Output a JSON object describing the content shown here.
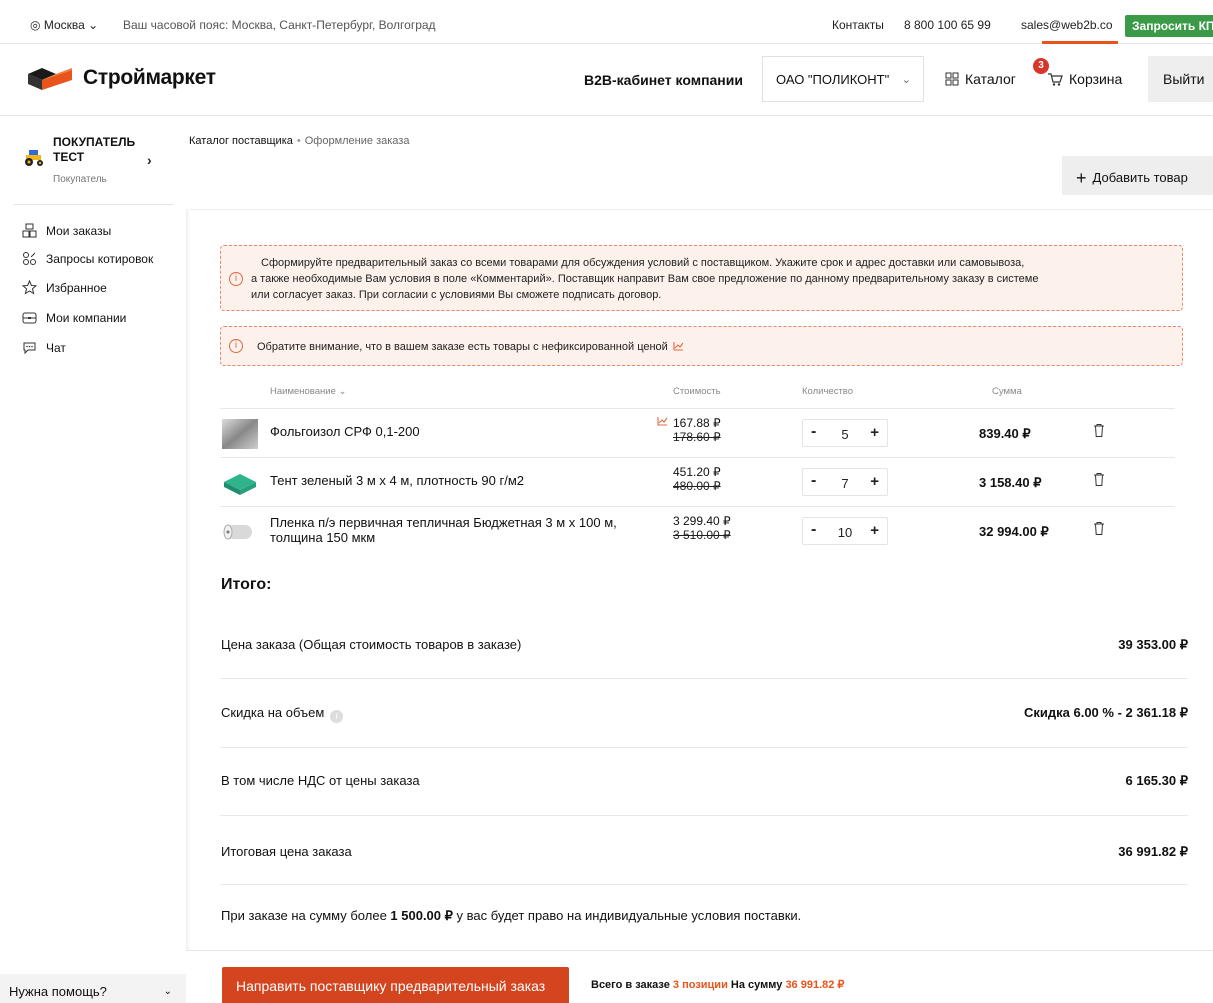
{
  "topbar": {
    "city": "Москва",
    "timezone": "Ваш часовой пояс: Москва, Санкт-Петербург, Волгоград",
    "contacts": "Контакты",
    "phone": "8 800 100 65 99",
    "email": "sales@web2b.co",
    "request_button": "Запросить КП"
  },
  "header": {
    "logo_text": "Строймаркет",
    "b2b_label": "B2B-кабинет компании",
    "company": "ОАО \"ПОЛИКОНТ\"",
    "catalog": "Каталог",
    "cart": "Корзина",
    "cart_count": "3",
    "logout": "Выйти"
  },
  "sidebar": {
    "user_name_line1": "ПОКУПАТЕЛЬ",
    "user_name_line2": "ТЕСТ",
    "user_role": "Покупатель",
    "items": [
      {
        "label": "Мои заказы",
        "icon": "orders-icon"
      },
      {
        "label": "Запросы котировок",
        "icon": "quotes-icon"
      },
      {
        "label": "Избранное",
        "icon": "star-icon"
      },
      {
        "label": "Мои компании",
        "icon": "briefcase-icon"
      },
      {
        "label": "Чат",
        "icon": "chat-icon"
      }
    ],
    "help": "Нужна помощь?"
  },
  "breadcrumb": {
    "parent": "Каталог поставщика",
    "current": "Оформление заказа"
  },
  "add_product_button": "Добавить товар",
  "notices": {
    "main_line1": "Сформируйте предварительный заказ со всеми товарами для обсуждения условий с поставщиком. Укажите срок и адрес доставки или самовывоза,",
    "main_line2": "а также необходимые Вам условия в поле «Комментарий». Поставщик направит Вам свое предложение по данному предварительному заказу в системе",
    "main_line3": "или согласует заказ. При согласии с условиями Вы сможете подписать договор.",
    "price_warning": "Обратите внимание, что в вашем заказе есть товары с нефиксированной ценой"
  },
  "table": {
    "columns": {
      "name": "Наименование",
      "price": "Стоимость",
      "quantity": "Количество",
      "sum": "Сумма"
    },
    "rows": [
      {
        "name": "Фольгоизол СРФ 0,1-200",
        "price": "167.88 ₽",
        "old_price": "178.60 ₽",
        "quantity": "5",
        "sum": "839.40 ₽",
        "floating_price": true
      },
      {
        "name": "Тент зеленый 3 м х 4 м, плотность 90 г/м2",
        "price": "451.20 ₽",
        "old_price": "480.00 ₽",
        "quantity": "7",
        "sum": "3 158.40 ₽",
        "floating_price": false
      },
      {
        "name_line1": "Пленка п/э первичная тепличная Бюджетная 3 м х 100 м,",
        "name_line2": "толщина 150 мкм",
        "price": "3 299.40 ₽",
        "old_price": "3 510.00 ₽",
        "quantity": "10",
        "sum": "32 994.00 ₽",
        "floating_price": false
      }
    ]
  },
  "totals": {
    "title": "Итого:",
    "order_price_label": "Цена заказа (Общая стоимость товаров в заказе)",
    "order_price_value": "39 353.00 ₽",
    "discount_label": "Скидка на объем",
    "discount_value": "Скидка 6.00 % - 2 361.18 ₽",
    "vat_label": "В том числе НДС от цены заказа",
    "vat_value": "6 165.30 ₽",
    "final_label": "Итоговая цена заказа",
    "final_value": "36 991.82 ₽",
    "note_before": "При заказе на сумму более ",
    "note_amount": "1 500.00 ₽",
    "note_after": " у вас будет право на индивидуальные условия поставки."
  },
  "bottom": {
    "submit_button": "Направить поставщику предварительный заказ",
    "total_label": "Всего в заказе",
    "positions": "3 позиции",
    "sum_label": "На сумму",
    "sum_value": "36 991.82 ₽"
  },
  "colors": {
    "accent": "#e8541c",
    "submit": "#d4451f",
    "request_button": "#3a9a48",
    "notice_border": "#e8866a",
    "notice_bg": "#fdf1ec"
  }
}
